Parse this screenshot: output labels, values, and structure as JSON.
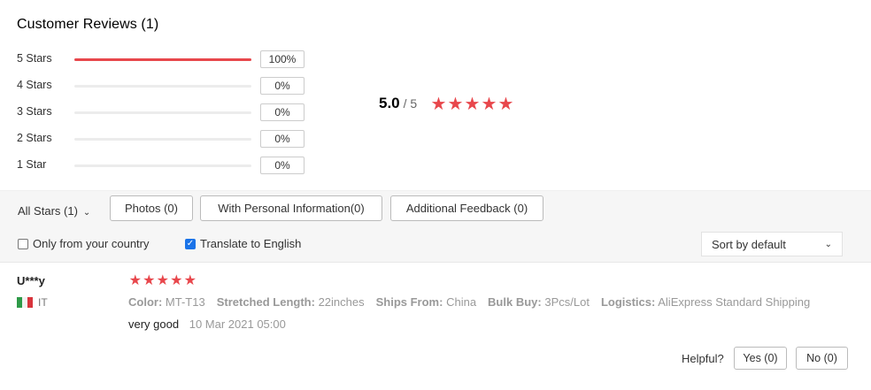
{
  "title": "Customer Reviews (1)",
  "distribution": [
    {
      "label": "5 Stars",
      "percent": "100%",
      "fraction": 1.0
    },
    {
      "label": "4 Stars",
      "percent": "0%",
      "fraction": 0
    },
    {
      "label": "3 Stars",
      "percent": "0%",
      "fraction": 0
    },
    {
      "label": "2 Stars",
      "percent": "0%",
      "fraction": 0
    },
    {
      "label": "1 Star",
      "percent": "0%",
      "fraction": 0
    }
  ],
  "overall": {
    "score": "5.0",
    "max": "/ 5",
    "stars": 5
  },
  "filters": {
    "all_stars": "All Stars (1)",
    "photos": "Photos (0)",
    "personal_info": "With Personal Information(0)",
    "additional_feedback": "Additional Feedback (0)",
    "only_country": "Only from your country",
    "only_country_checked": false,
    "translate": "Translate to English",
    "translate_checked": true,
    "sort": "Sort by default"
  },
  "review": {
    "user": "U***y",
    "country": "IT",
    "stars": 5,
    "attributes": [
      {
        "key": "Color:",
        "value": "MT-T13"
      },
      {
        "key": "Stretched Length:",
        "value": "22inches"
      },
      {
        "key": "Ships From:",
        "value": "China"
      },
      {
        "key": "Bulk Buy:",
        "value": "3Pcs/Lot"
      },
      {
        "key": "Logistics:",
        "value": "AliExpress Standard Shipping"
      }
    ],
    "text": "very good",
    "date": "10 Mar 2021 05:00"
  },
  "helpful": {
    "label": "Helpful?",
    "yes": "Yes (0)",
    "no": "No (0)"
  },
  "colors": {
    "accent": "#e8474c",
    "checkbox": "#1a73e8"
  }
}
